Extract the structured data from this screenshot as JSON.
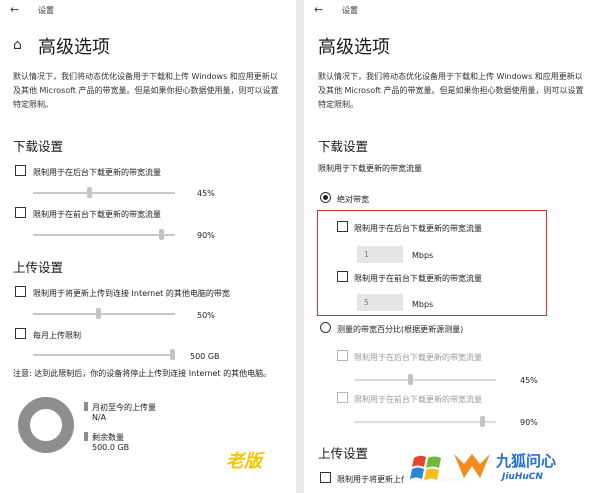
{
  "left": {
    "app_title": "设置",
    "heading": "高级选项",
    "description": "默认情况下，我们将动态优化设备用于下载和上传 Windows 和应用更新以及其他 Microsoft 产品的带宽量。但是如果你担心数据使用量，则可以设置特定限制。",
    "download": {
      "title": "下载设置",
      "background": {
        "label": "限制用于在后台下载更新的带宽流量",
        "value": "45%",
        "level": 0.45
      },
      "foreground": {
        "label": "限制用于在前台下载更新的带宽流量",
        "value": "90%",
        "level": 0.9
      }
    },
    "upload": {
      "title": "上传设置",
      "internet": {
        "label": "限制用于将更新上传到连接 Internet 的其他电脑的带宽",
        "value": "50%",
        "level": 0.5
      },
      "monthly": {
        "label": "每月上传限制",
        "value": "500 GB",
        "level": 1.0
      }
    },
    "note": "注意: 达到此限制后，你的设备将停止上传到连接 Internet 的其他电脑。",
    "stats": {
      "uploaded_label": "月初至今的上传量",
      "uploaded_value": "N/A",
      "remaining_label": "剩余数量",
      "remaining_value": "500.0 GB"
    },
    "stamp": "老版"
  },
  "right": {
    "app_title": "设置",
    "heading": "高级选项",
    "description": "默认情况下，我们将动态优化设备用于下载和上传 Windows 和应用更新以及其他 Microsoft 产品的带宽量。但是如果你担心数据使用量，则可以设置特定限制。",
    "download": {
      "title": "下载设置",
      "subtitle": "限制用于下载更新的带宽流量",
      "absolute": {
        "label": "绝对带宽",
        "background": {
          "label": "限制用于在后台下载更新的带宽流量",
          "value": "1",
          "unit": "Mbps"
        },
        "foreground": {
          "label": "限制用于在前台下载更新的带宽流量",
          "value": "5",
          "unit": "Mbps"
        }
      },
      "percentage": {
        "label": "测量的带宽百分比(根据更新源测量)",
        "background": {
          "label": "限制用于在后台下载更新的带宽流量",
          "value": "45%",
          "level": 0.45
        },
        "foreground": {
          "label": "限制用于在前台下载更新的带宽流量",
          "value": "90%",
          "level": 0.9
        }
      }
    },
    "upload": {
      "title": "上传设置",
      "internet": {
        "label": "限制用于将更新上传到连接 Internet"
      }
    }
  },
  "watermark": {
    "brand": "九狐问心",
    "domain": "JiuHuCN"
  },
  "colors": {
    "accent_red": "#d32f2f",
    "stamp_yellow": "#f5c400",
    "brand_blue": "#1e6fd8"
  }
}
